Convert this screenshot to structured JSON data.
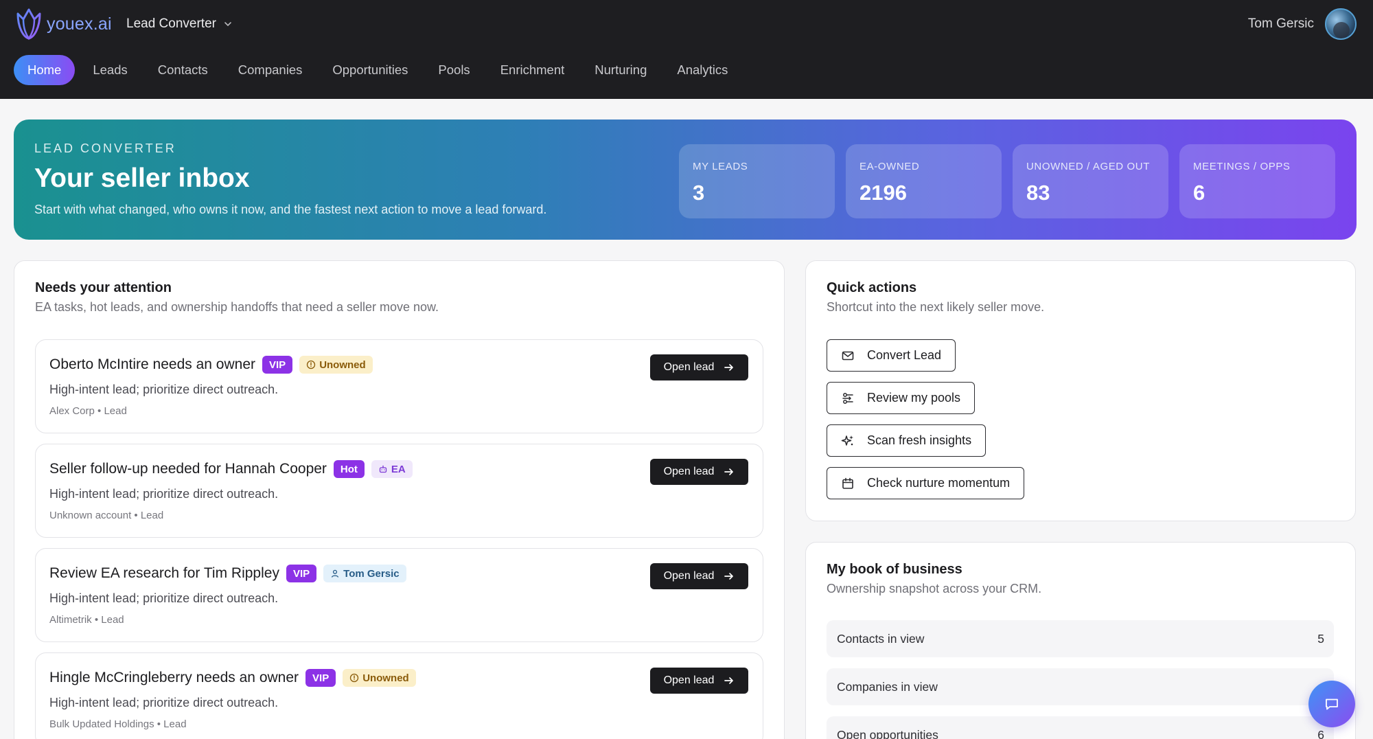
{
  "brand": {
    "logo_text": "youex.ai"
  },
  "app_switcher": {
    "label": "Lead Converter"
  },
  "user": {
    "name": "Tom Gersic"
  },
  "nav": {
    "items": [
      {
        "label": "Home",
        "active": true
      },
      {
        "label": "Leads"
      },
      {
        "label": "Contacts"
      },
      {
        "label": "Companies"
      },
      {
        "label": "Opportunities"
      },
      {
        "label": "Pools"
      },
      {
        "label": "Enrichment"
      },
      {
        "label": "Nurturing"
      },
      {
        "label": "Analytics"
      }
    ]
  },
  "hero": {
    "eyebrow": "LEAD CONVERTER",
    "title": "Your seller inbox",
    "subtitle": "Start with what changed, who owns it now, and the fastest next action to move a lead forward.",
    "stats": [
      {
        "label": "MY LEADS",
        "value": "3"
      },
      {
        "label": "EA-OWNED",
        "value": "2196"
      },
      {
        "label": "UNOWNED / AGED OUT",
        "value": "83"
      },
      {
        "label": "MEETINGS / OPPS",
        "value": "6"
      }
    ]
  },
  "attention": {
    "title": "Needs your attention",
    "subtitle": "EA tasks, hot leads, and ownership handoffs that need a seller move now.",
    "open_label": "Open lead",
    "items": [
      {
        "title": "Oberto McIntire needs an owner",
        "badge1": "VIP",
        "badge2": "Unowned",
        "badge2_icon": "alert-circle-icon",
        "desc": "High-intent lead; prioritize direct outreach.",
        "meta": "Alex Corp • Lead"
      },
      {
        "title": "Seller follow-up needed for Hannah Cooper",
        "badge1": "Hot",
        "badge2": "EA",
        "badge2_icon": "robot-icon",
        "desc": "High-intent lead; prioritize direct outreach.",
        "meta": "Unknown account • Lead"
      },
      {
        "title": "Review EA research for Tim Rippley",
        "badge1": "VIP",
        "badge2": "Tom Gersic",
        "badge2_icon": "user-icon",
        "desc": "High-intent lead; prioritize direct outreach.",
        "meta": "Altimetrik • Lead"
      },
      {
        "title": "Hingle McCringleberry needs an owner",
        "badge1": "VIP",
        "badge2": "Unowned",
        "badge2_icon": "alert-circle-icon",
        "desc": "High-intent lead; prioritize direct outreach.",
        "meta": "Bulk Updated Holdings • Lead"
      }
    ]
  },
  "quick_actions": {
    "title": "Quick actions",
    "subtitle": "Shortcut into the next likely seller move.",
    "buttons": [
      {
        "label": "Convert Lead",
        "icon": "mail-icon"
      },
      {
        "label": "Review my pools",
        "icon": "pools-icon"
      },
      {
        "label": "Scan fresh insights",
        "icon": "sparkles-icon"
      },
      {
        "label": "Check nurture momentum",
        "icon": "calendar-icon"
      }
    ]
  },
  "book": {
    "title": "My book of business",
    "subtitle": "Ownership snapshot across your CRM.",
    "rows": [
      {
        "label": "Contacts in view",
        "value": "5"
      },
      {
        "label": "Companies in view",
        "value": ""
      },
      {
        "label": "Open opportunities",
        "value": "6"
      }
    ]
  },
  "colors": {
    "accent_start": "#3d8ff5",
    "accent_end": "#8a4cf3",
    "vip": "#8c32e6",
    "topbar": "#1e1e21"
  }
}
